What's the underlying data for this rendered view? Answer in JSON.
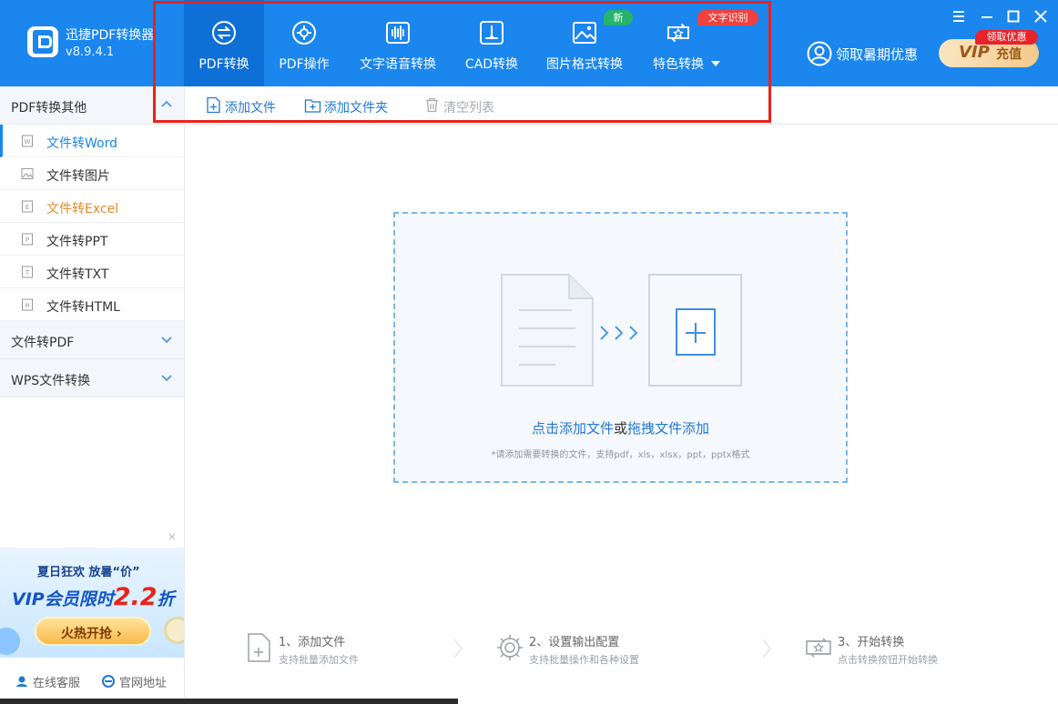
{
  "app": {
    "name": "迅捷PDF转换器",
    "version": "v8.9.4.1"
  },
  "nav": {
    "tabs": [
      {
        "label": "PDF转换",
        "icon": "convert-icon"
      },
      {
        "label": "PDF操作",
        "icon": "gear-doc-icon"
      },
      {
        "label": "文字语音转换",
        "icon": "waveform-icon"
      },
      {
        "label": "CAD转换",
        "icon": "cad-icon"
      },
      {
        "label": "图片格式转换",
        "icon": "image-icon"
      },
      {
        "label": "特色转换",
        "icon": "star-cycle-icon"
      }
    ],
    "badge_new": "新",
    "badge_ocr": "文字识别"
  },
  "header": {
    "promo_label": "领取暑期优惠",
    "vip_text": "VIP",
    "vip_charge": "充值",
    "vip_badge": "领取优惠"
  },
  "toolbar": {
    "add_file": "添加文件",
    "add_folder": "添加文件夹",
    "clear_list": "清空列表"
  },
  "sidebar": {
    "section1": "PDF转换其他",
    "items": [
      {
        "label": "文件转Word",
        "icon": "word-doc-icon"
      },
      {
        "label": "文件转图片",
        "icon": "image-doc-icon"
      },
      {
        "label": "文件转Excel",
        "icon": "excel-doc-icon"
      },
      {
        "label": "文件转PPT",
        "icon": "ppt-doc-icon"
      },
      {
        "label": "文件转TXT",
        "icon": "txt-doc-icon"
      },
      {
        "label": "文件转HTML",
        "icon": "html-doc-icon"
      }
    ],
    "section2": "文件转PDF",
    "section3": "WPS文件转换",
    "ad": {
      "line1": "夏日狂欢 放暑“价”",
      "line2_prefix": "VIP会员限时",
      "line2_big": "2.2",
      "line2_suffix": "折",
      "button": "火热开抢 ›",
      "close": "×"
    },
    "footer": {
      "service": "在线客服",
      "website": "官网地址"
    }
  },
  "dropzone": {
    "link1": "点击添加文件",
    "or": "或",
    "link2": "拖拽文件添加",
    "hint": "*请添加需要转换的文件，支持pdf，xls，xlsx，ppt，pptx格式"
  },
  "steps": [
    {
      "title": "1、添加文件",
      "desc": "支持批量添加文件"
    },
    {
      "title": "2、设置输出配置",
      "desc": "支持批量操作和各种设置"
    },
    {
      "title": "3、开始转换",
      "desc": "点击转换按钮开始转换"
    }
  ],
  "colors": {
    "brand": "#1a86ee",
    "highlight": "#e8231c",
    "link": "#2178d5"
  }
}
